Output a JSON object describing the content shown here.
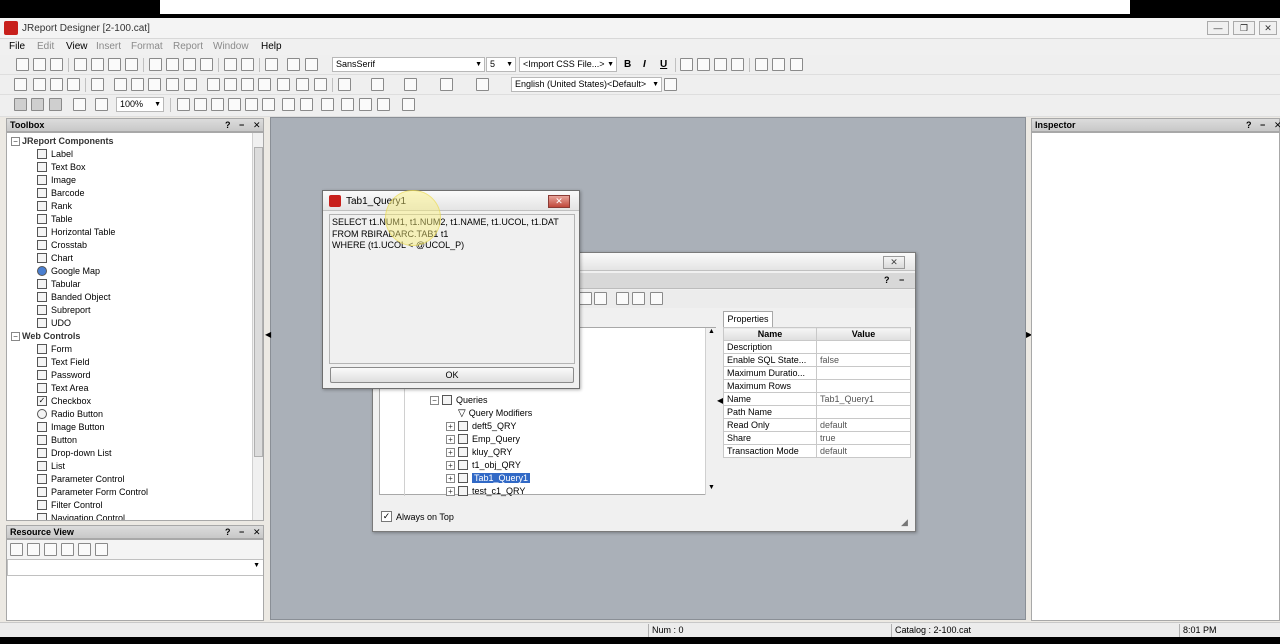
{
  "window": {
    "title": "JReport Designer [2-100.cat]",
    "minimize": "—",
    "restore": "❐",
    "close": "✕"
  },
  "menu": [
    "File",
    "Edit",
    "View",
    "Insert",
    "Format",
    "Report",
    "Window",
    "Help"
  ],
  "toolbar": {
    "font_family": "SansSerif",
    "font_size": "5",
    "css_import": "<Import CSS File...>",
    "bold": "B",
    "italic": "I",
    "underline": "U",
    "locale": "English (United States)<Default>",
    "zoom": "100%"
  },
  "toolbox": {
    "title": "Toolbox",
    "help": "?",
    "minimize": "−",
    "close": "✕",
    "groups": [
      {
        "label": "JReport Components",
        "items": [
          "Label",
          "Text Box",
          "Image",
          "Barcode",
          "Rank",
          "Table",
          "Horizontal Table",
          "Crosstab",
          "Chart",
          "Google Map",
          "Tabular",
          "Banded Object",
          "Subreport",
          "UDO"
        ]
      },
      {
        "label": "Web Controls",
        "items": [
          "Form",
          "Text Field",
          "Password",
          "Text Area",
          "Checkbox",
          "Radio Button",
          "Image Button",
          "Button",
          "Drop-down List",
          "List",
          "Parameter Control",
          "Parameter Form Control",
          "Filter Control",
          "Navigation Control"
        ]
      }
    ]
  },
  "resource_view": {
    "title": "Resource View",
    "help": "?",
    "minimize": "−",
    "close": "✕"
  },
  "inspector": {
    "title": "Inspector",
    "help": "?",
    "minimize": "−",
    "close": "✕"
  },
  "query_dialog": {
    "title": "Tab1_Query1",
    "sql_lines": [
      "SELECT t1.NUM1, t1.NUM2, t1.NAME, t1.UCOL, t1.DAT",
      "FROM RBIRADARC.TAB1 t1",
      "WHERE (t1.UCOL < @UCOL_P)"
    ],
    "ok_label": "OK",
    "close": "✕"
  },
  "catalog_dialog": {
    "close": "✕",
    "help": "?",
    "minimize": "−",
    "tree": {
      "queries_label": "Queries",
      "query_modifiers_label": "Query Modifiers",
      "items": [
        "deft5_QRY",
        "Emp_Query",
        "kluy_QRY",
        "t1_obj_QRY",
        "Tab1_Query1",
        "test_c1_QRY"
      ],
      "selected": "Tab1_Query1"
    },
    "properties_tab": "Properties",
    "columns": [
      "Name",
      "Value"
    ],
    "properties": [
      {
        "name": "Description",
        "value": ""
      },
      {
        "name": "Enable SQL State...",
        "value": "false"
      },
      {
        "name": "Maximum Duratio...",
        "value": ""
      },
      {
        "name": "Maximum Rows",
        "value": ""
      },
      {
        "name": "Name",
        "value": "Tab1_Query1"
      },
      {
        "name": "Path Name",
        "value": ""
      },
      {
        "name": "Read Only",
        "value": "default"
      },
      {
        "name": "Share",
        "value": "true"
      },
      {
        "name": "Transaction Mode",
        "value": "default"
      }
    ],
    "always_on_top_label": "Always on Top",
    "always_on_top": true
  },
  "status": {
    "num": "Num : 0",
    "catalog": "Catalog : 2-100.cat",
    "time": "8:01 PM"
  },
  "colors": {
    "canvas": "#aab0b8",
    "selected": "#3169c6",
    "brand_red": "#c8201c"
  }
}
